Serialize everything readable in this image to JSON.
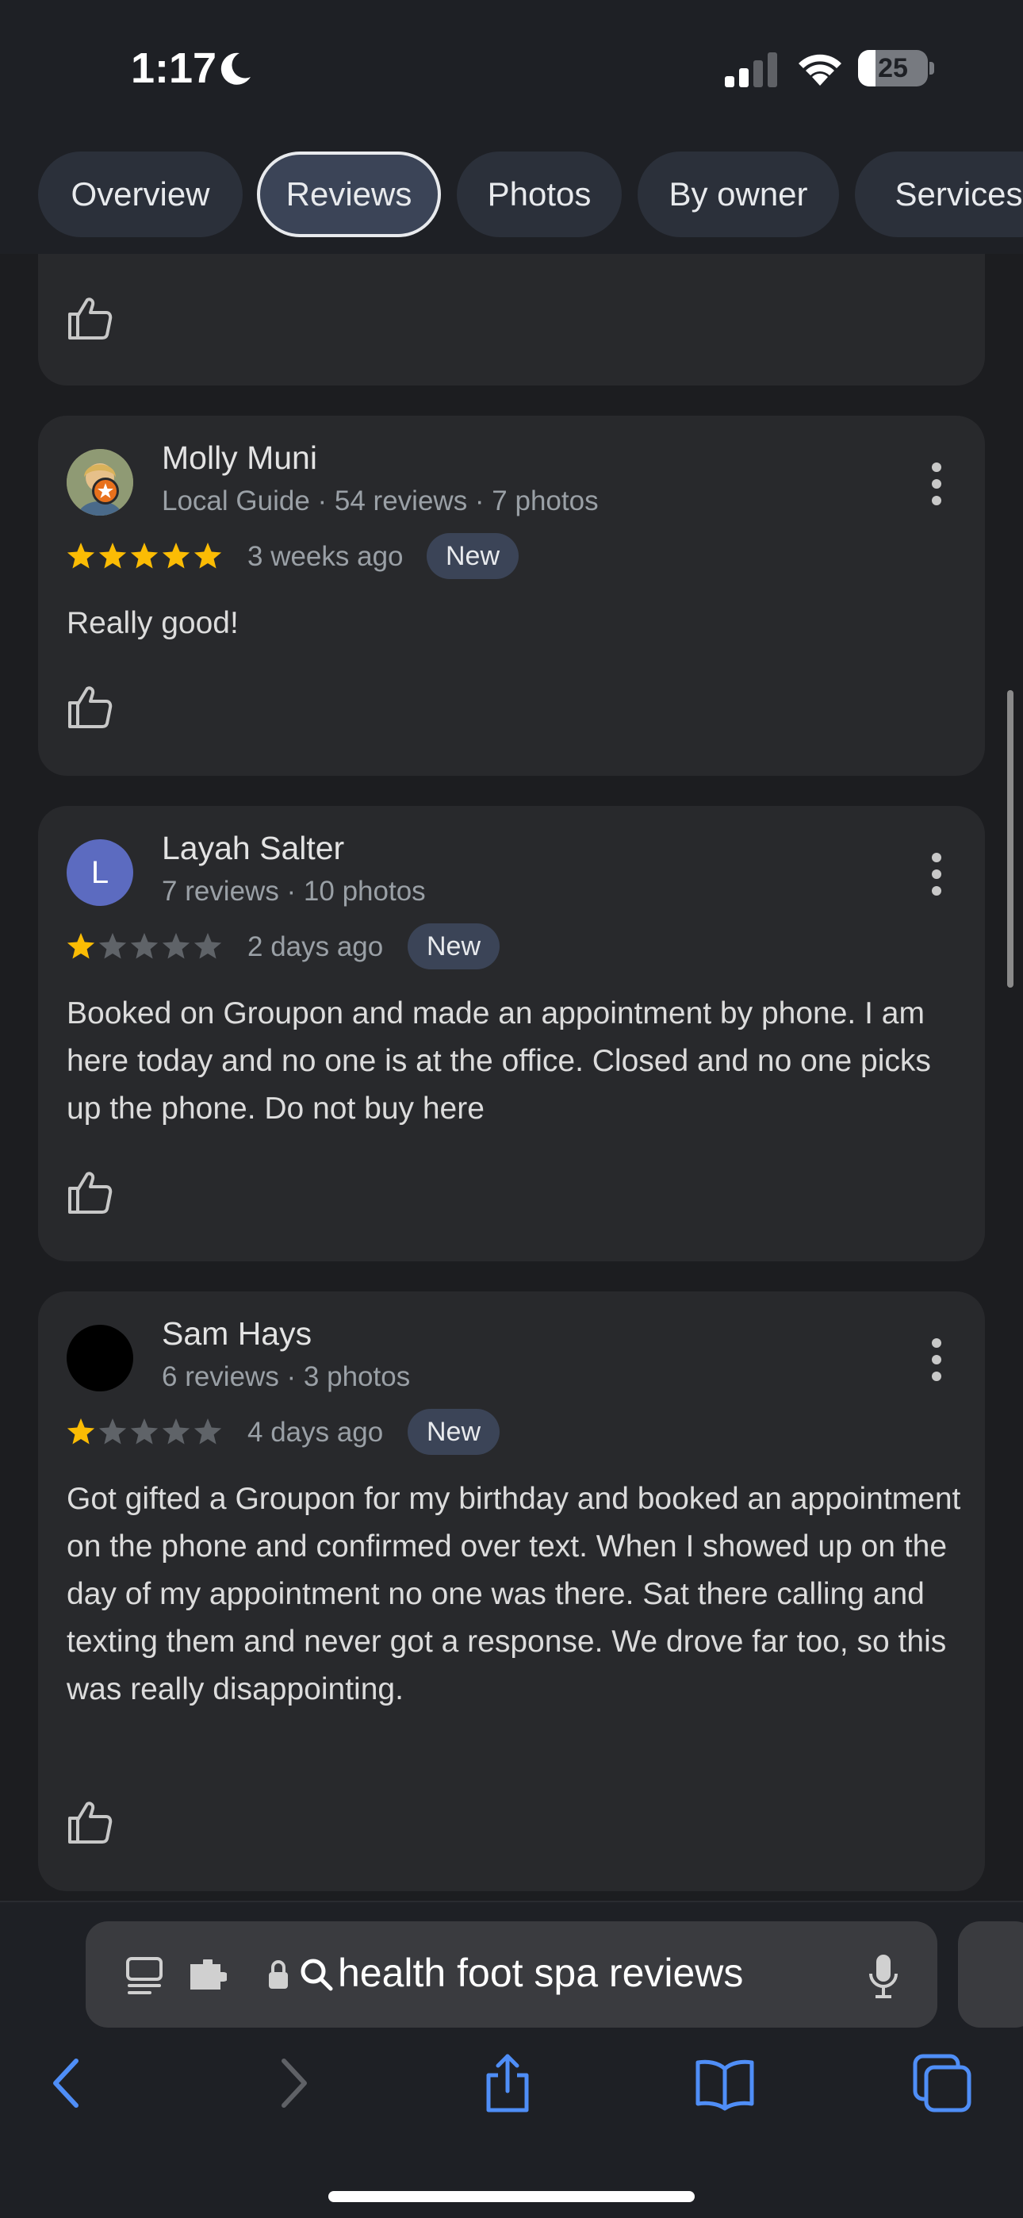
{
  "status_bar": {
    "time": "1:17",
    "battery_level": "25",
    "icons": [
      "moon-icon",
      "signal-icon",
      "wifi-icon",
      "battery-icon"
    ]
  },
  "tabs": [
    {
      "label": "Overview",
      "active": false
    },
    {
      "label": "Reviews",
      "active": true
    },
    {
      "label": "Photos",
      "active": false
    },
    {
      "label": "By owner",
      "active": false
    },
    {
      "label": "Services",
      "active": false
    }
  ],
  "reviews": [
    {
      "name": "Molly Muni",
      "meta": "Local Guide · 54 reviews · 7 photos",
      "rating": 5,
      "when": "3 weeks ago",
      "badge": "New",
      "text": "Really good!",
      "avatar_letter": ""
    },
    {
      "name": "Layah Salter",
      "meta": "7 reviews · 10 photos",
      "rating": 1,
      "when": "2 days ago",
      "badge": "New",
      "text": "Booked on Groupon and made an appointment by phone. I am here today and no one is at the office. Closed and no one picks up the phone. Do not buy here",
      "avatar_letter": "L"
    },
    {
      "name": "Sam Hays",
      "meta": "6 reviews · 3 photos",
      "rating": 1,
      "when": "4 days ago",
      "badge": "New",
      "text": "Got gifted a Groupon for my birthday and booked an appointment on the phone and confirmed over text. When I showed up on the day of my appointment no one was there. Sat there calling and texting them and never got a response. We drove far too, so this was really disappointing.",
      "avatar_letter": ""
    }
  ],
  "address_bar": {
    "text": "health foot spa reviews"
  },
  "colors": {
    "star_filled": "#fbbc04",
    "star_empty": "#5f6368",
    "accent_blue": "#4f8ef7",
    "avatar_purple": "#5c6bc0"
  }
}
